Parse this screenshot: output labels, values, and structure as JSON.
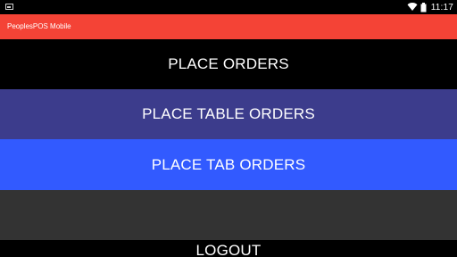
{
  "status_bar": {
    "time": "11:17",
    "icons": [
      "gallery-notification-icon",
      "wifi-icon",
      "battery-icon"
    ]
  },
  "app_bar": {
    "title": "PeoplesPOS Mobile",
    "color": "#f44336"
  },
  "menu": {
    "place_orders": "PLACE ORDERS",
    "place_table_orders": "PLACE TABLE ORDERS",
    "place_tab_orders": "PLACE TAB ORDERS",
    "blank": "",
    "logout": "LOGOUT"
  },
  "colors": {
    "background": "#000000",
    "table_orders": "#3c3c8c",
    "tab_orders": "#325aff",
    "blank_button": "#333333"
  }
}
